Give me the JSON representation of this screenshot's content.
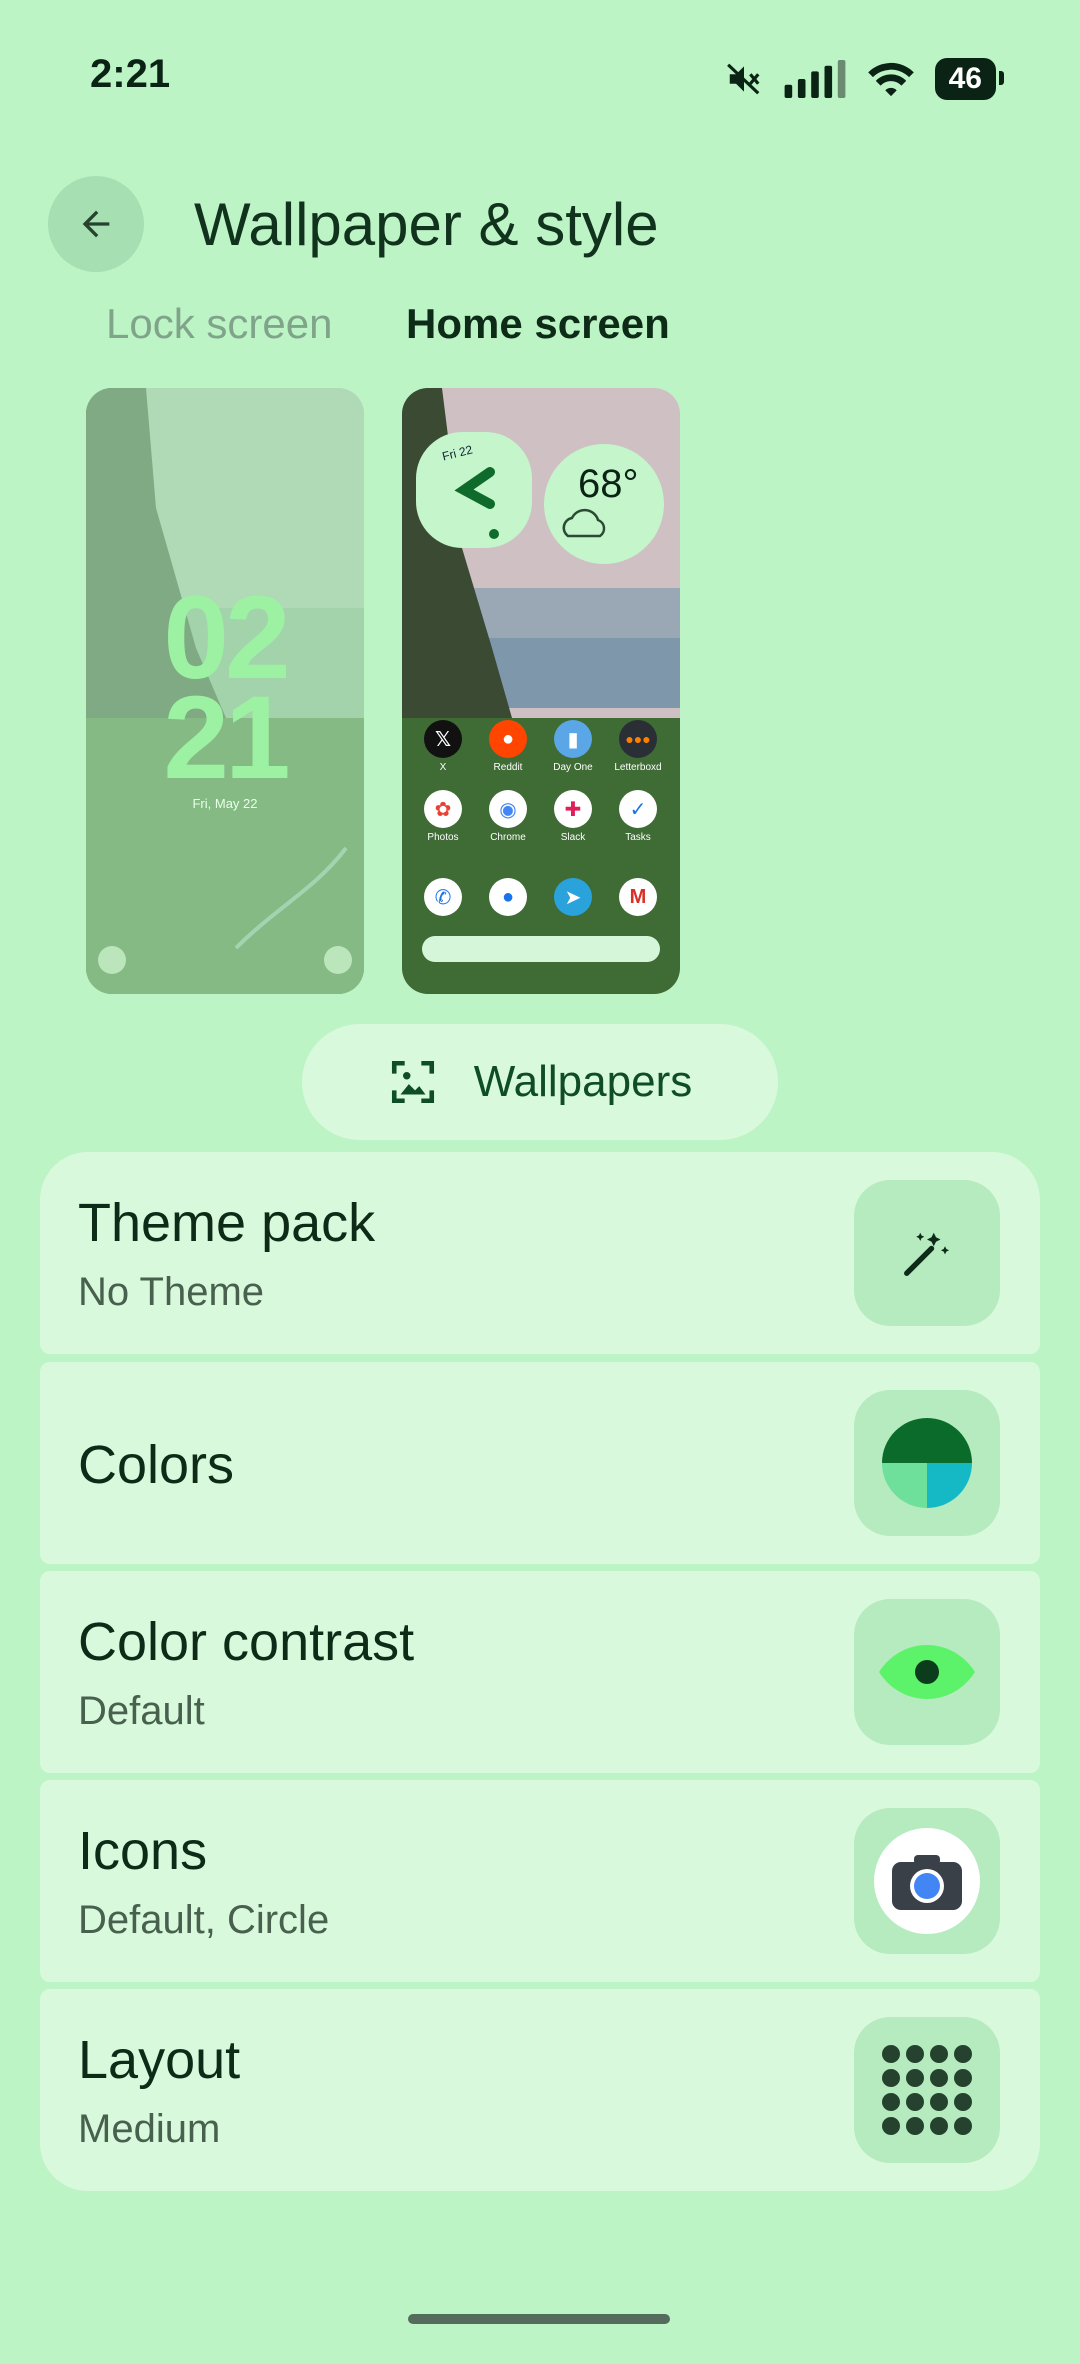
{
  "status_bar": {
    "time": "2:21",
    "battery": "46"
  },
  "header": {
    "title": "Wallpaper & style"
  },
  "tabs": [
    {
      "label": "Lock screen"
    },
    {
      "label": "Home screen"
    }
  ],
  "lock_preview": {
    "clock_top": "02",
    "clock_bottom": "21",
    "date": "Fri, May 22"
  },
  "home_preview": {
    "clock_date": "Fri 22",
    "weather_temp": "68°",
    "apps_row1": [
      "X",
      "Reddit",
      "Day One",
      "Letterboxd"
    ],
    "apps_row2": [
      "Photos",
      "Chrome",
      "Slack",
      "Tasks"
    ]
  },
  "wallpapers_button": {
    "label": "Wallpapers"
  },
  "options": [
    {
      "title": "Theme pack",
      "subtitle": "No Theme",
      "icon": "magic-wand-icon"
    },
    {
      "title": "Colors",
      "subtitle": "",
      "icon": "color-palette-icon"
    },
    {
      "title": "Color contrast",
      "subtitle": "Default",
      "icon": "eye-icon"
    },
    {
      "title": "Icons",
      "subtitle": "Default, Circle",
      "icon": "camera-app-icon"
    },
    {
      "title": "Layout",
      "subtitle": "Medium",
      "icon": "grid-layout-icon"
    }
  ]
}
